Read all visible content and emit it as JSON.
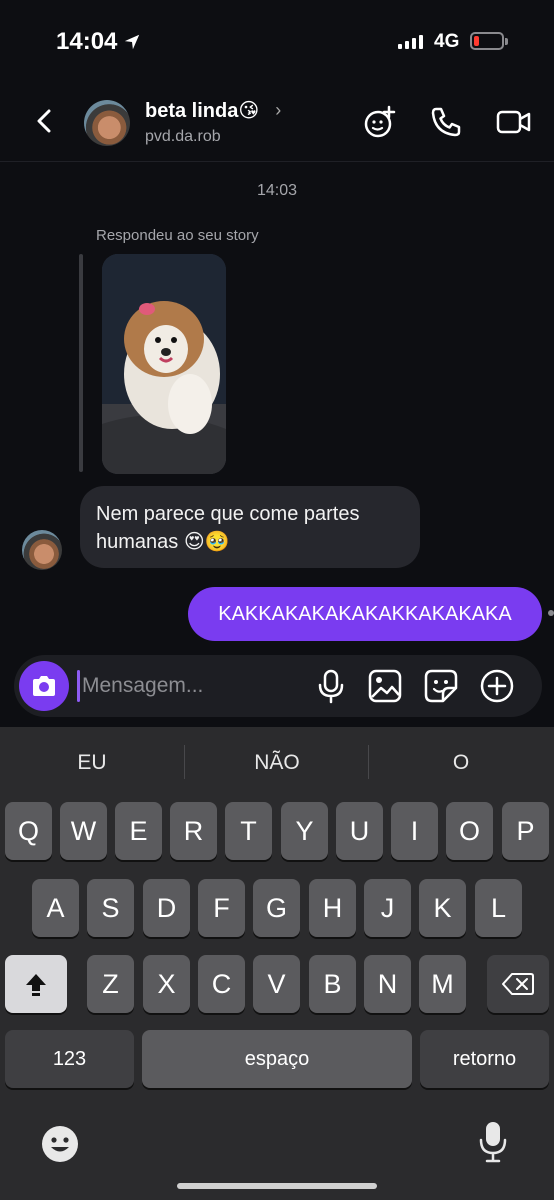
{
  "status_bar": {
    "time": "14:04",
    "network": "4G"
  },
  "header": {
    "contact_name": "beta linda😘",
    "username": "pvd.da.rob"
  },
  "chat": {
    "timestamp": "14:03",
    "story_reply_label": "Respondeu ao seu story",
    "incoming_message": "Nem parece que come partes humanas 😍🥹",
    "outgoing_message": "KAKKAKAKAKAKAKKAKAKAKA"
  },
  "composer": {
    "placeholder": "Mensagem..."
  },
  "keyboard": {
    "suggestions": [
      "EU",
      "NÃO",
      "O"
    ],
    "row1": [
      "Q",
      "W",
      "E",
      "R",
      "T",
      "Y",
      "U",
      "I",
      "O",
      "P"
    ],
    "row2": [
      "A",
      "S",
      "D",
      "F",
      "G",
      "H",
      "J",
      "K",
      "L"
    ],
    "row3": [
      "Z",
      "X",
      "C",
      "V",
      "B",
      "N",
      "M"
    ],
    "numbers_label": "123",
    "space_label": "espaço",
    "return_label": "retorno"
  },
  "colors": {
    "accent": "#7a3cf0",
    "background": "#0d0e12",
    "incoming_bubble": "#26272d"
  }
}
